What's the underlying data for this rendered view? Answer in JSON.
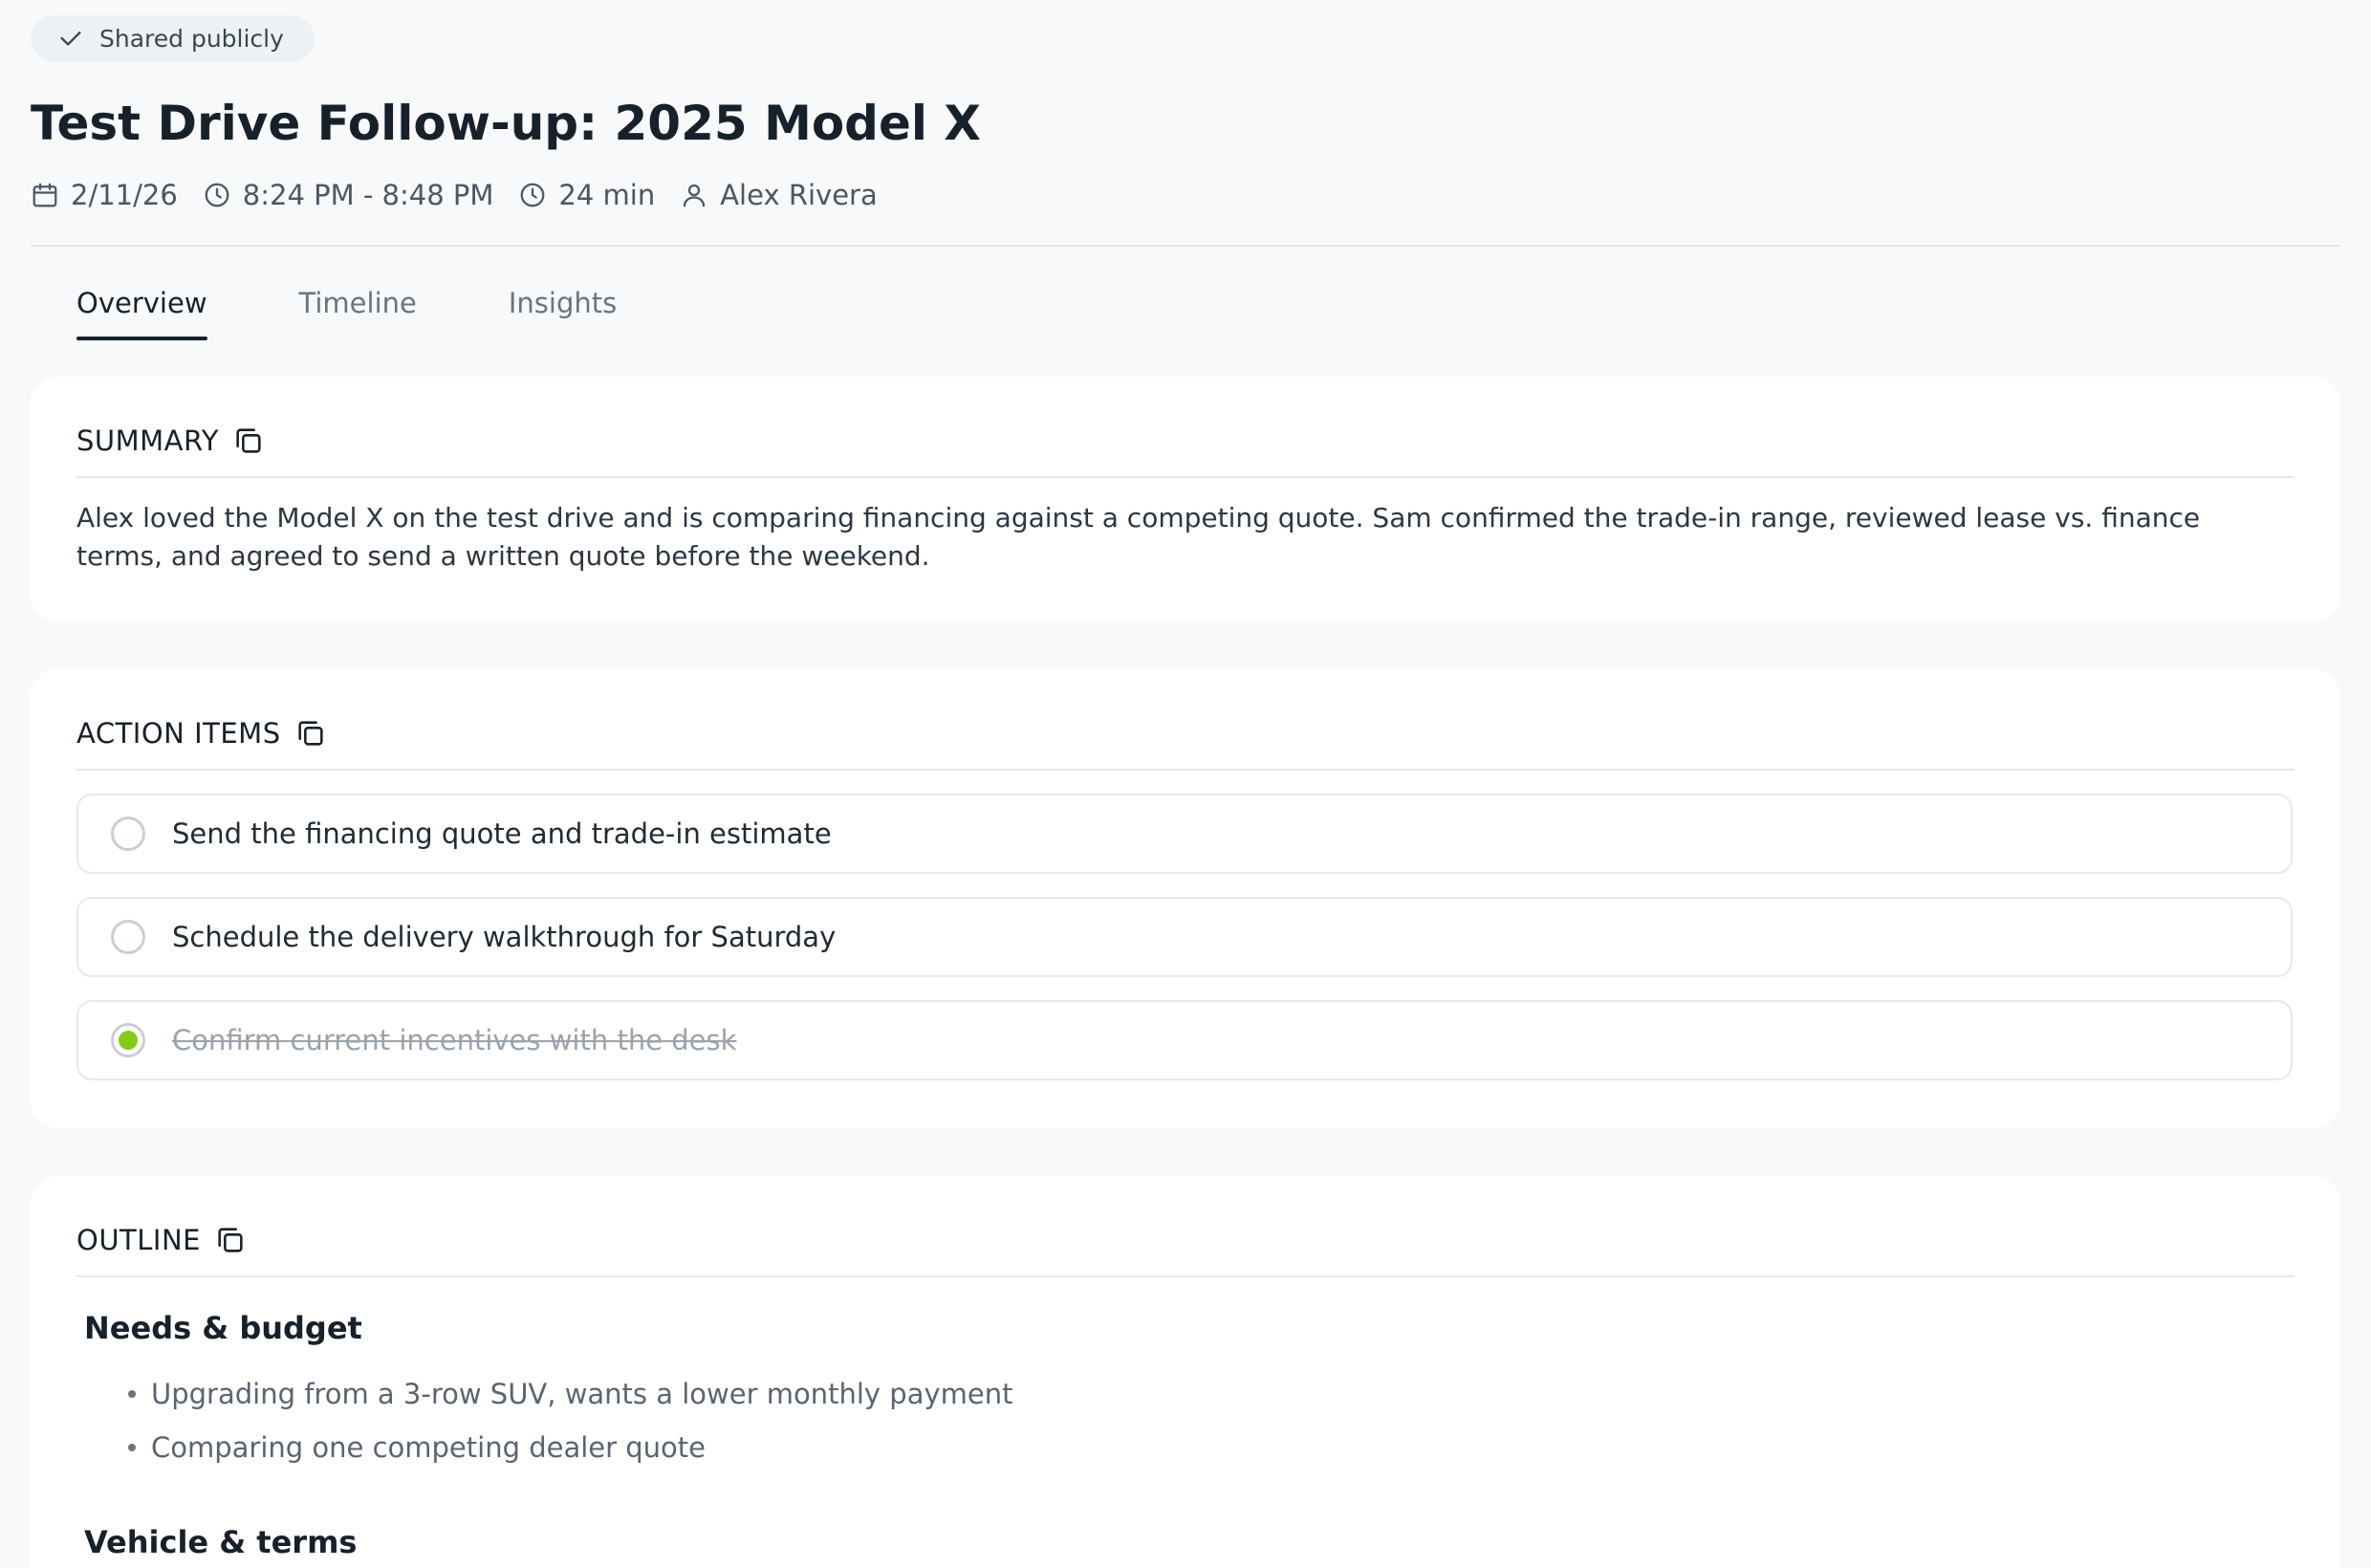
{
  "share": {
    "label": "Shared publicly",
    "icon": "check-icon"
  },
  "meeting": {
    "title": "Test Drive Follow-up: 2025 Model X",
    "date": "2/11/26",
    "time_range": "8:24 PM - 8:48 PM",
    "duration": "24 min",
    "participant": "Alex Rivera"
  },
  "tabs": [
    {
      "label": "Overview",
      "active": true
    },
    {
      "label": "Timeline",
      "active": false
    },
    {
      "label": "Insights",
      "active": false
    }
  ],
  "summary": {
    "heading": "SUMMARY",
    "text": "Alex loved the Model X on the test drive and is comparing financing against a competing quote. Sam confirmed the trade-in range, reviewed lease vs. finance terms, and agreed to send a written quote before the weekend."
  },
  "action_items": {
    "heading": "ACTION ITEMS",
    "items": [
      {
        "text": "Send the financing quote and trade-in estimate",
        "done": false
      },
      {
        "text": "Schedule the delivery walkthrough for Saturday",
        "done": false
      },
      {
        "text": "Confirm current incentives with the desk",
        "done": true
      }
    ]
  },
  "outline": {
    "heading": "OUTLINE",
    "sections": [
      {
        "title": "Needs & budget",
        "bullets": [
          "Upgrading from a 3-row SUV, wants a lower monthly payment",
          "Comparing one competing dealer quote"
        ]
      },
      {
        "title": "Vehicle & terms",
        "bullets": []
      }
    ]
  },
  "colors": {
    "accent": "#17212b",
    "done": "#84cc16",
    "page_bg": "#f7f9fa",
    "card_bg": "#ffffff"
  }
}
